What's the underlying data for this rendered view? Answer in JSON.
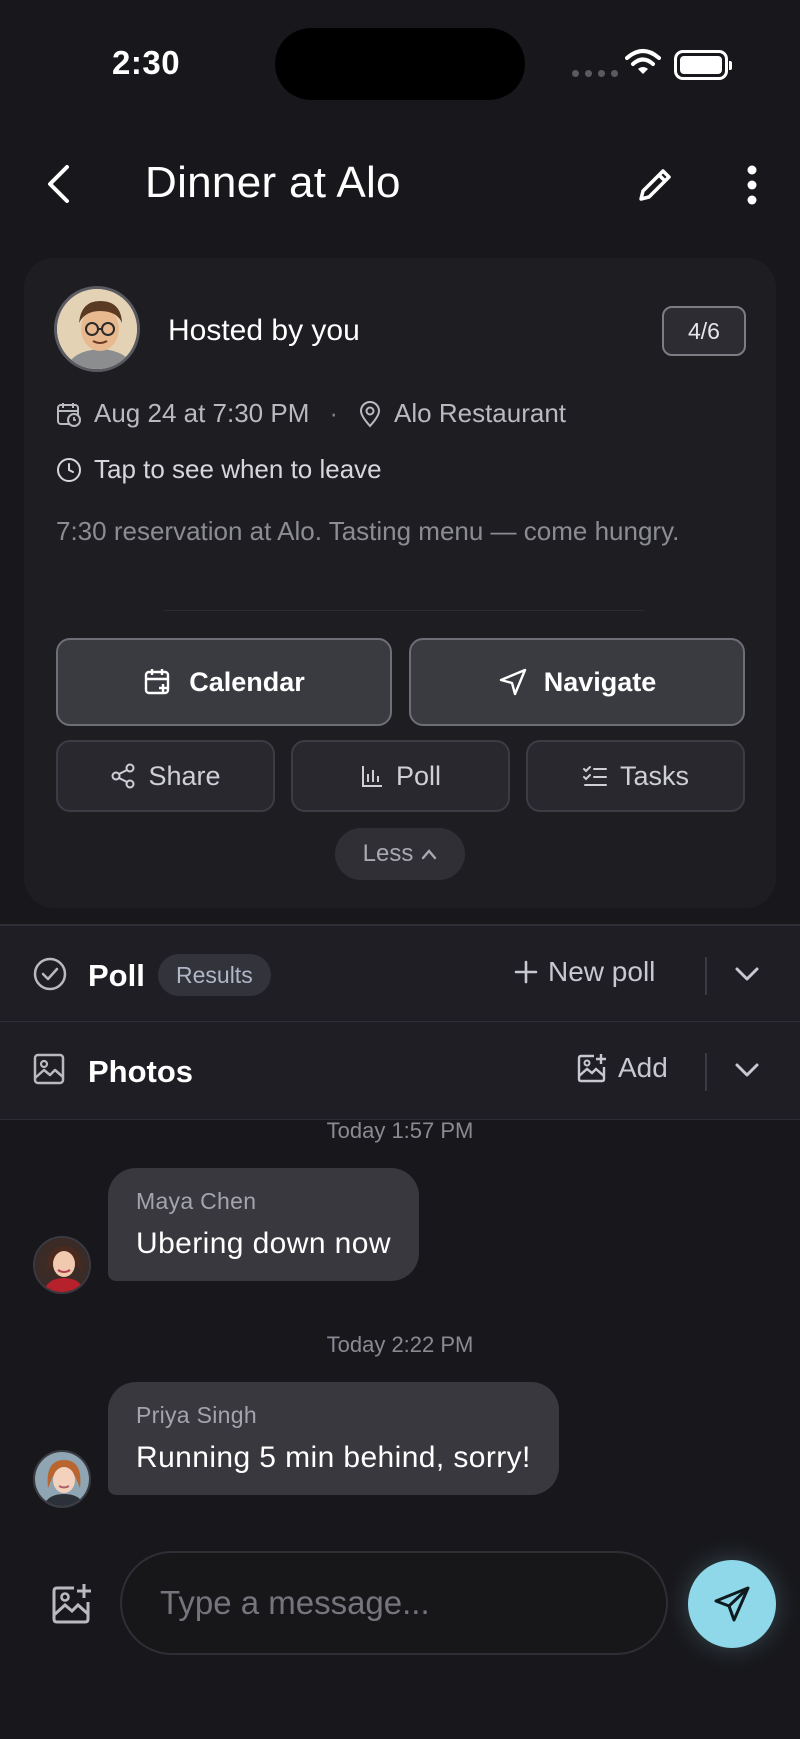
{
  "status_bar": {
    "time": "2:30"
  },
  "header": {
    "title": "Dinner at Alo"
  },
  "event": {
    "host_label": "Hosted by you",
    "attendee_count": "4/6",
    "date_time": "Aug 24 at 7:30 PM",
    "separator": "·",
    "location": "Alo Restaurant",
    "leave_hint": "Tap to see when to leave",
    "description": "7:30 reservation at Alo. Tasting menu — come hungry.",
    "buttons": {
      "calendar": "Calendar",
      "navigate": "Navigate",
      "share": "Share",
      "poll": "Poll",
      "tasks": "Tasks",
      "less": "Less"
    }
  },
  "sections": {
    "poll": {
      "title": "Poll",
      "badge": "Results",
      "action": "New poll"
    },
    "photos": {
      "title": "Photos",
      "action": "Add"
    }
  },
  "chat": {
    "messages": [
      {
        "timestamp": "Today 1:57 PM",
        "sender": "Maya Chen",
        "text": "Ubering down now"
      },
      {
        "timestamp": "Today 2:22 PM",
        "sender": "Priya Singh",
        "text": "Running 5 min behind, sorry!"
      }
    ]
  },
  "composer": {
    "placeholder": "Type a message..."
  },
  "colors": {
    "background": "#18181c",
    "card": "#1d1d22",
    "bubble": "#38383e",
    "send_accent": "#8fd8ea"
  },
  "icons": [
    "back-arrow-icon",
    "pencil-icon",
    "more-vertical-icon",
    "calendar-clock-icon",
    "map-pin-icon",
    "clock-icon",
    "calendar-plus-icon",
    "navigation-arrow-icon",
    "share-icon",
    "bar-chart-icon",
    "checklist-icon",
    "chevron-up-icon",
    "check-circle-icon",
    "plus-icon",
    "chevron-down-icon",
    "image-icon",
    "image-plus-icon",
    "send-icon"
  ]
}
